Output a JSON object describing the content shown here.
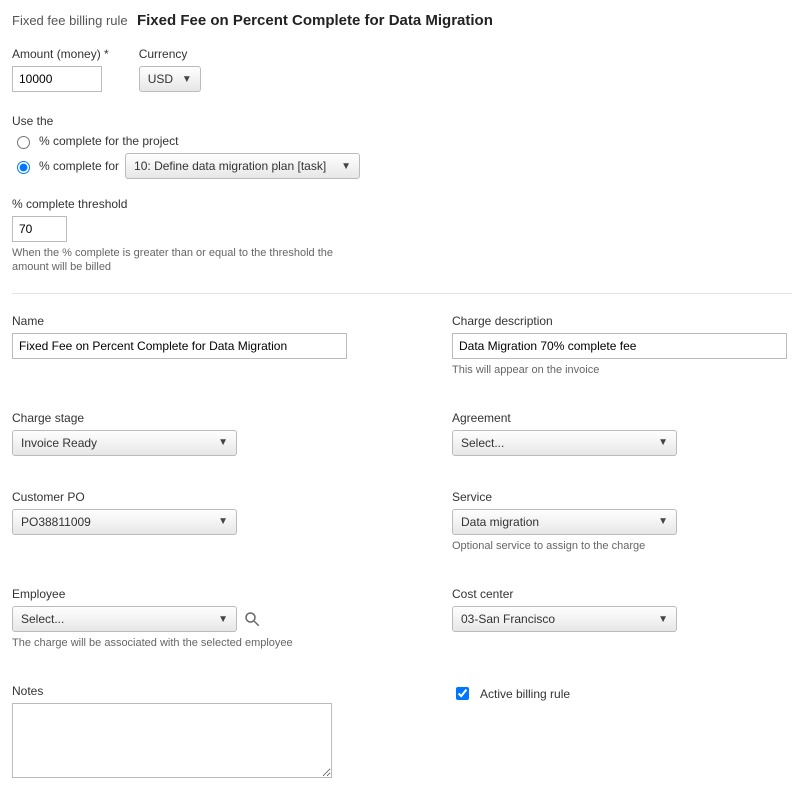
{
  "header": {
    "prefix": "Fixed fee billing rule",
    "title": "Fixed Fee on Percent Complete for Data Migration"
  },
  "amount": {
    "label": "Amount (money)",
    "required_mark": "*",
    "value": "10000"
  },
  "currency": {
    "label": "Currency",
    "value": "USD"
  },
  "use_the": {
    "label": "Use the",
    "option_project": "% complete for the project",
    "option_for": "% complete for",
    "task_value": "10: Define data migration plan [task]"
  },
  "threshold": {
    "label": "% complete threshold",
    "value": "70",
    "hint": "When the % complete is greater than or equal to the threshold the amount will be billed"
  },
  "name": {
    "label": "Name",
    "value": "Fixed Fee on Percent Complete for Data Migration"
  },
  "charge_desc": {
    "label": "Charge description",
    "value": "Data Migration 70% complete fee",
    "hint": "This will appear on the invoice"
  },
  "charge_stage": {
    "label": "Charge stage",
    "value": "Invoice Ready"
  },
  "agreement": {
    "label": "Agreement",
    "value": "Select..."
  },
  "customer_po": {
    "label": "Customer PO",
    "value": "PO38811009"
  },
  "service": {
    "label": "Service",
    "value": "Data migration",
    "hint": "Optional service to assign to the charge"
  },
  "employee": {
    "label": "Employee",
    "value": "Select...",
    "hint": "The charge will be associated with the selected employee"
  },
  "cost_center": {
    "label": "Cost center",
    "value": "03-San Francisco"
  },
  "notes": {
    "label": "Notes",
    "value": ""
  },
  "active": {
    "label": "Active billing rule"
  }
}
